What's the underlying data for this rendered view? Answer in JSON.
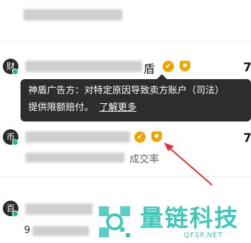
{
  "rows": [
    {
      "avatar": "财",
      "name_tail": "盾",
      "price": "7"
    },
    {
      "avatar": "币",
      "price": "7",
      "rate_label": "成交率"
    },
    {
      "avatar": "百"
    }
  ],
  "tooltip": {
    "line1": "神盾广告方：对特定原因导致卖方账户（司法）",
    "line2": "提供限额赔付。",
    "link": "了解更多"
  },
  "row3_partial": "9",
  "badge_check_icon": "✔",
  "watermark": {
    "title": "量链科技",
    "sub": "QFSP.NET"
  },
  "colors": {
    "badge": "#f0a500",
    "online": "#1fb97a",
    "tooltip_bg": "#2d2d2f",
    "arrow": "#e5312b",
    "watermark": "#3ec7b8"
  }
}
